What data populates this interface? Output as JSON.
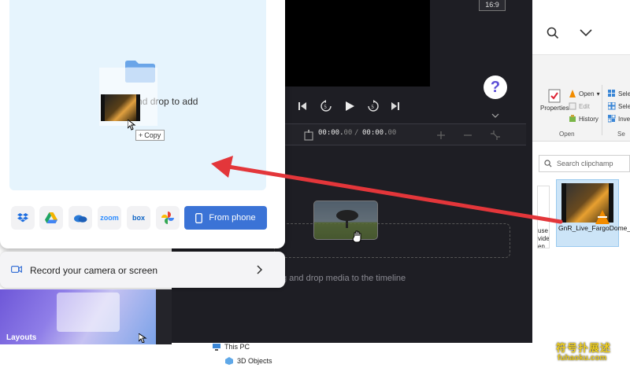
{
  "import_panel": {
    "drop_text": "Drag and drop to add",
    "copy_tip": "Copy",
    "copy_tip_icon": "plus",
    "sources": [
      {
        "name": "dropbox-icon",
        "color": "#1f6fe0"
      },
      {
        "name": "google-drive-icon",
        "color": "#1fa463"
      },
      {
        "name": "onedrive-icon",
        "color": "#2a7ad6"
      },
      {
        "name": "zoom-icon",
        "color": "#2d8cff",
        "label": "zoom"
      },
      {
        "name": "box-icon",
        "color": "#0c63c5",
        "label": "box"
      },
      {
        "name": "google-photos-icon",
        "color": "#f4b400"
      }
    ],
    "phone_button": "From phone"
  },
  "record_bar": {
    "label": "Record your camera or screen"
  },
  "layouts": {
    "label": "Layouts"
  },
  "editor": {
    "aspect_ratio": "16:9",
    "help_label": "?",
    "time_current_main": "00:00.",
    "time_current_frac": "00",
    "time_sep": " / ",
    "time_total_main": "00:00.",
    "time_total_frac": "00",
    "timeline_hint": "g and drop media to the timeline"
  },
  "explorer": {
    "ribbon": {
      "open_label": "Open",
      "edit_label": "Edit",
      "history_label": "History",
      "properties_label": "Properties",
      "group_open_label": "Open",
      "select_1": "Sele",
      "select_2": "Sele",
      "invert": "Inve",
      "group_select_label": "Se"
    },
    "search_placeholder": "Search clipchamp",
    "file_name": "GnR_Live_FargoDome_2021.mp4",
    "partial_file_text": "use\nvideo\nen\nong",
    "tree": [
      {
        "label": "This PC"
      },
      {
        "label": "3D Objects"
      }
    ]
  },
  "watermark": {
    "cn": "符号扑展述",
    "domain": "fuhaoku.com"
  }
}
